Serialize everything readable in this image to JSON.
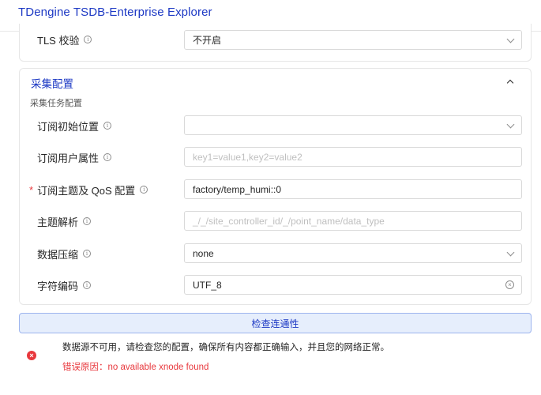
{
  "app": {
    "title": "TDengine TSDB-Enterprise Explorer"
  },
  "tls": {
    "label": "TLS 校验",
    "value": "不开启"
  },
  "collect": {
    "title": "采集配置",
    "subtitle": "采集任务配置",
    "rows": [
      {
        "label": "订阅初始位置",
        "value": "",
        "placeholder": ""
      },
      {
        "label": "订阅用户属性",
        "value": "",
        "placeholder": "key1=value1,key2=value2"
      },
      {
        "label": "订阅主题及 QoS 配置",
        "value": "factory/temp_humi::0",
        "placeholder": "",
        "required": "*"
      },
      {
        "label": "主题解析",
        "value": "",
        "placeholder": "_/_/site_controller_id/_/point_name/data_type"
      },
      {
        "label": "数据压缩",
        "value": "none",
        "placeholder": ""
      },
      {
        "label": "字符编码",
        "value": "UTF_8",
        "placeholder": ""
      }
    ]
  },
  "actions": {
    "check_label": "检查连通性"
  },
  "error": {
    "message": "数据源不可用，请检查您的配置，确保所有内容都正确输入，并且您的网络正常。",
    "reason": "错误原因：no available xnode found"
  }
}
